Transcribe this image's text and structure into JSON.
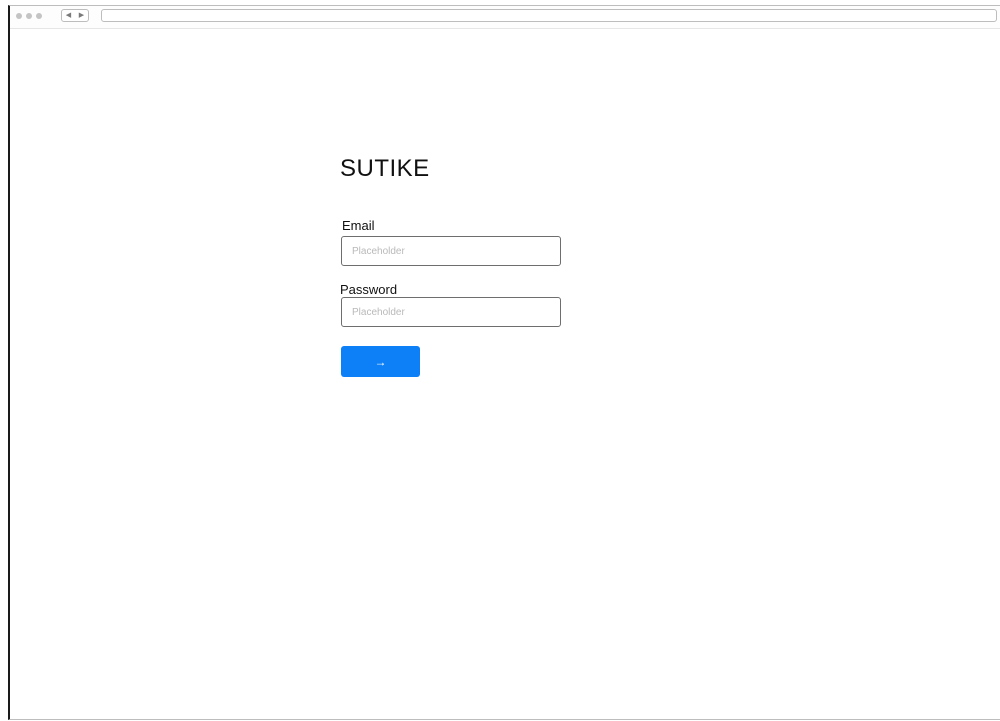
{
  "browser": {
    "back_glyph": "◀",
    "forward_glyph": "▶",
    "address": ""
  },
  "login": {
    "brand": "SUTIKE",
    "email_label": "Email",
    "email_placeholder": "Placeholder",
    "email_value": "",
    "password_label": "Password",
    "password_placeholder": "Placeholder",
    "password_value": "",
    "submit_glyph": "→"
  },
  "icons": {
    "submit": "arrow-right-icon",
    "back": "chevron-left-icon",
    "forward": "chevron-right-icon"
  },
  "colors": {
    "accent": "#0d7ff7",
    "input_border": "#6e6e6e",
    "placeholder": "#b9b9b9"
  }
}
